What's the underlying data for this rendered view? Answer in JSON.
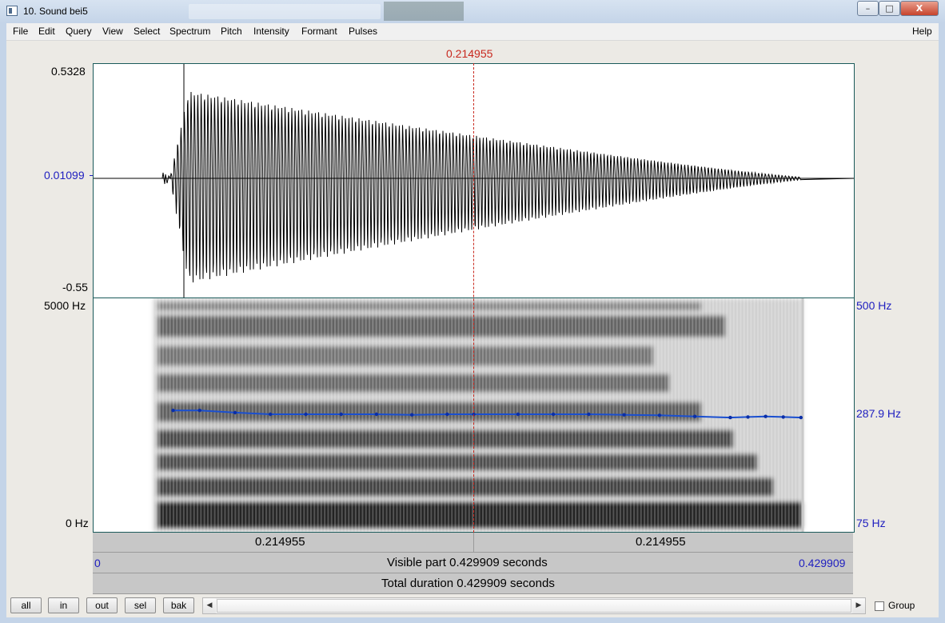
{
  "window": {
    "title": "10. Sound bei5",
    "buttons": {
      "minimize": "–",
      "maximize": "□",
      "close": "X"
    }
  },
  "menu": {
    "items": [
      "File",
      "Edit",
      "Query",
      "View",
      "Select",
      "Spectrum",
      "Pitch",
      "Intensity",
      "Formant",
      "Pulses"
    ],
    "help": "Help"
  },
  "cursor": {
    "time_label": "0.214955",
    "time": 0.214955
  },
  "waveform": {
    "y_max_label": "0.5328",
    "y_mid_label": "0.01099",
    "y_min_label": "-0.55"
  },
  "spectrogram": {
    "freq_top_label": "5000 Hz",
    "freq_bottom_label": "0 Hz",
    "pitch_top_label": "500 Hz",
    "pitch_value_label": "287.9 Hz",
    "pitch_bottom_label": "75 Hz"
  },
  "time_bar": {
    "left_segment_label": "0.214955",
    "right_segment_label": "0.214955",
    "visible_start": "0",
    "visible_label": "Visible part 0.429909 seconds",
    "visible_end": "0.429909",
    "total_label": "Total duration 0.429909 seconds"
  },
  "buttons": {
    "all": "all",
    "in": "in",
    "out": "out",
    "sel": "sel",
    "bak": "bak"
  },
  "group_checkbox": {
    "label": "Group",
    "checked": false
  },
  "colors": {
    "cursor": "#c8281e",
    "pitch": "#1a4fd0",
    "axis_blue": "#2020c0"
  },
  "pitch_track": {
    "unit": "Hz",
    "times_s": [
      0.045,
      0.06,
      0.08,
      0.1,
      0.12,
      0.14,
      0.16,
      0.18,
      0.2,
      0.215,
      0.24,
      0.26,
      0.28,
      0.3,
      0.32,
      0.34,
      0.36,
      0.37,
      0.38,
      0.39,
      0.4
    ],
    "values_hz": [
      296,
      296,
      292,
      289,
      289,
      289,
      289,
      288,
      289,
      289,
      289,
      289,
      289,
      288,
      287,
      285,
      283,
      284,
      285,
      284,
      283
    ]
  }
}
